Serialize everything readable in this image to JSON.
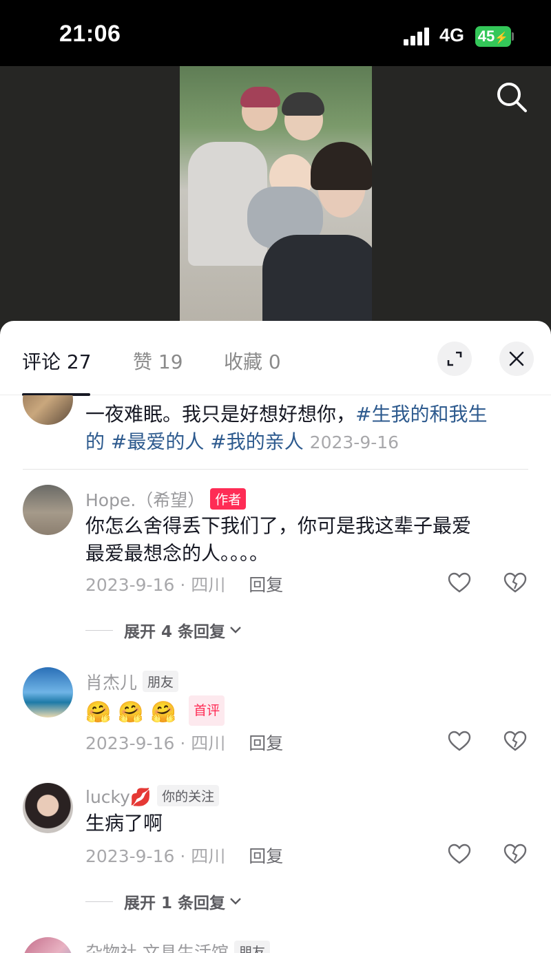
{
  "status_bar": {
    "time": "21:06",
    "network": "4G",
    "battery": "45"
  },
  "tabs": [
    {
      "label": "评论 27"
    },
    {
      "label": "赞 19"
    },
    {
      "label": "收藏 0"
    }
  ],
  "comments": [
    {
      "text_plain": "一夜难眠。我只是好想好想你，",
      "hashtag1": "#生我的和我生的",
      "hashtag1_a": "#生我的和我生",
      "hashtag1_b": "的",
      "hashtag2": "#最爱的人",
      "hashtag3": "#我的亲人",
      "date": "2023-9-16"
    },
    {
      "user": "Hope.（希望）",
      "badge": "作者",
      "line1": "你怎么舍得丢下我们了，你可是我这辈子最爱",
      "line2": "最爱最想念的人。。。。",
      "meta": "2023-9-16 · 四川",
      "reply": "回复",
      "expand": "展开 4 条回复"
    },
    {
      "user": "肖杰儿",
      "badge": "朋友",
      "emoji": [
        "🤗",
        "🤗",
        "🤗"
      ],
      "first_badge": "首评",
      "meta": "2023-9-16 · 四川",
      "reply": "回复"
    },
    {
      "user": "lucky",
      "user_emoji": "💋",
      "badge": "你的关注",
      "text": "生病了啊",
      "meta": "2023-9-16 · 四川",
      "reply": "回复",
      "expand": "展开 1 条回复"
    },
    {
      "user": "杂物社 文具生活馆",
      "badge": "朋友"
    }
  ],
  "colors": {
    "accent": "#fe2c55",
    "hashtag": "#2d5a8e",
    "battery": "#34c759"
  }
}
